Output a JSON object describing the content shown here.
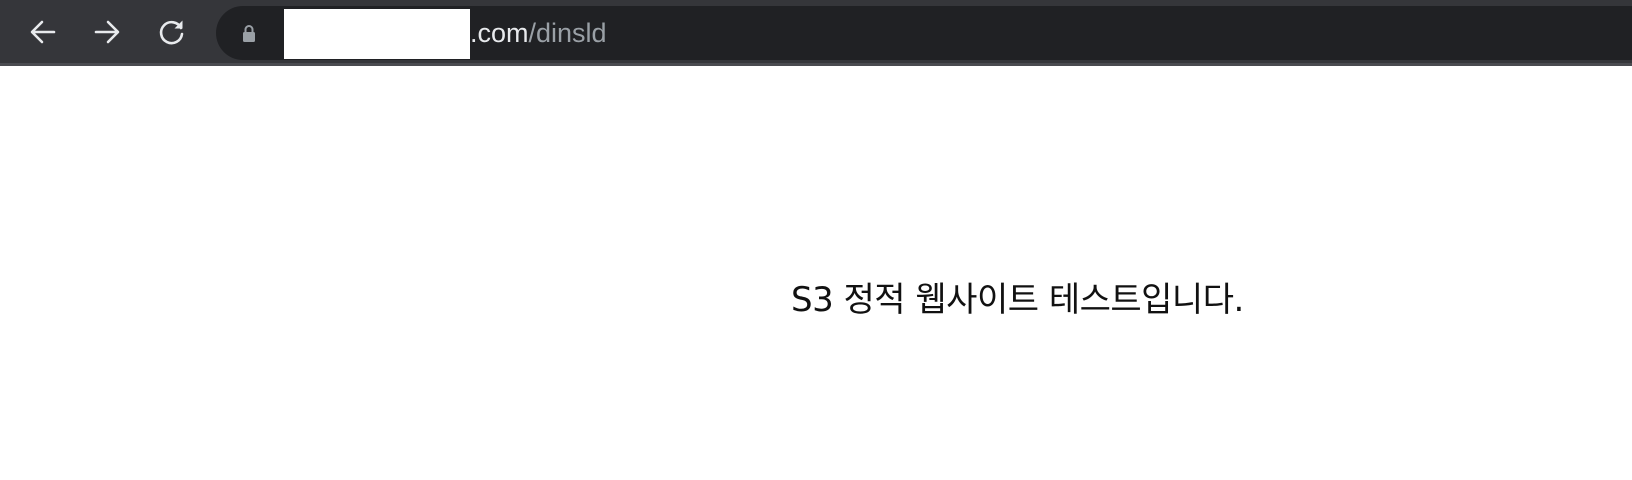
{
  "browser": {
    "address_bar": {
      "host_visible": ".com",
      "path": "/dinsld",
      "redacted": true
    },
    "icons": {
      "back": "arrow-left-icon",
      "forward": "arrow-right-icon",
      "reload": "reload-icon",
      "secure": "lock-icon"
    },
    "colors": {
      "toolbar_bg": "#35363a",
      "omnibox_bg": "#202124",
      "url_host": "#e8eaed",
      "url_path": "#9aa0a6"
    }
  },
  "page": {
    "message": "S3 정적 웹사이트 테스트입니다."
  }
}
